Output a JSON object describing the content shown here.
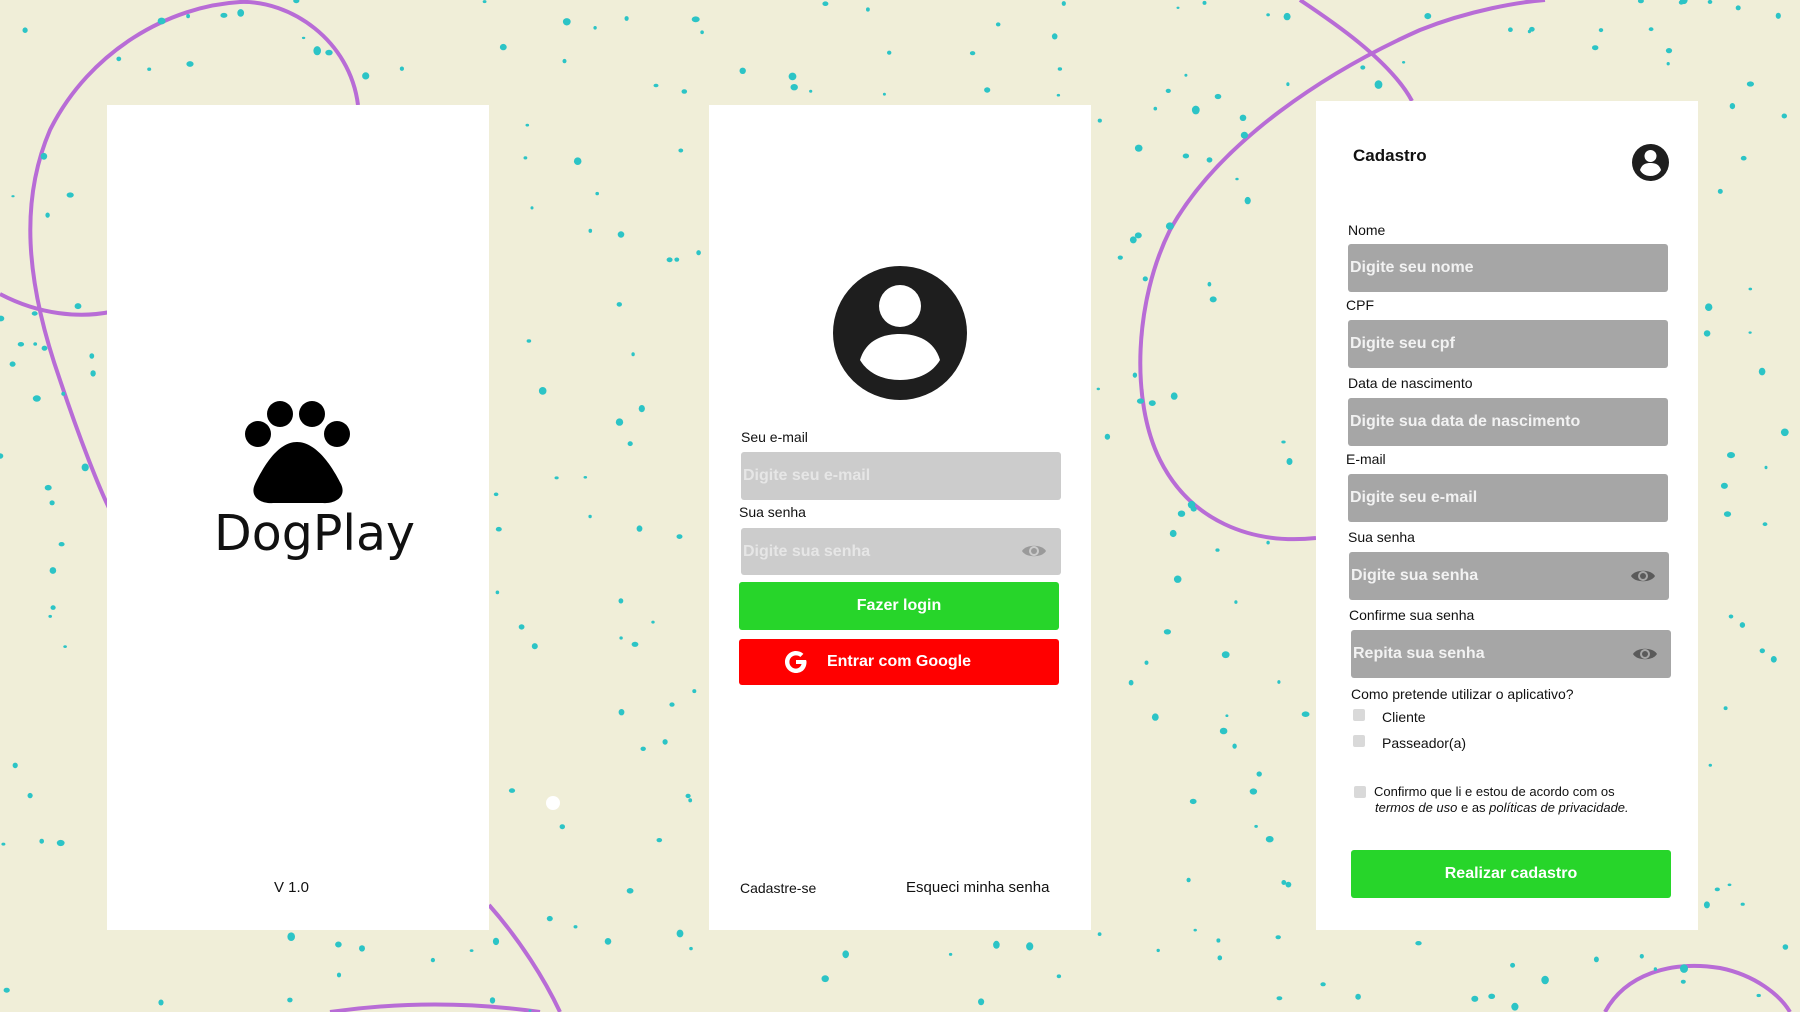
{
  "colors": {
    "background": "#f0eed8",
    "decor_curve": "#b86cd6",
    "decor_dots": "#2cc4c6",
    "login_button": "#27d52a",
    "google_button": "#ff0000",
    "field_login": "#cccccc",
    "field_register": "#a6a6a6",
    "icon_dark": "#1e1e1e"
  },
  "splash": {
    "app_name": "DogPlay",
    "logo_icon": "paw-icon",
    "version": "V 1.0"
  },
  "login": {
    "avatar_icon": "user-circle-icon",
    "email_label": "Seu e-mail",
    "email_placeholder": "Digite seu e-mail",
    "password_label": "Sua senha",
    "password_placeholder": "Digite sua senha",
    "password_toggle_icon": "eye-icon",
    "login_button": "Fazer login",
    "google_icon": "google-g-icon",
    "google_button": "Entrar com Google",
    "signup_link": "Cadastre-se",
    "forgot_link": "Esqueci minha senha"
  },
  "register": {
    "title": "Cadastro",
    "profile_icon": "user-circle-icon",
    "name_label": "Nome",
    "name_placeholder": "Digite seu nome",
    "cpf_label": "CPF",
    "cpf_placeholder": "Digite seu cpf",
    "birth_label": "Data de nascimento",
    "birth_placeholder": "Digite sua data de nascimento",
    "email_label": "E-mail",
    "email_placeholder": "Digite seu e-mail",
    "password_label": "Sua senha",
    "password_placeholder": "Digite sua senha",
    "confirm_label": "Confirme sua senha",
    "confirm_placeholder": "Repita sua senha",
    "usage_question": "Como pretende utilizar o aplicativo?",
    "option_client": "Cliente",
    "option_walker": "Passeador(a)",
    "terms_line1": "Confirmo que li e estou de acordo com os",
    "terms_of_use": "termos de uso",
    "terms_and": " e as ",
    "privacy_policies": "políticas de privacidade",
    "terms_period": ".",
    "submit_button": "Realizar cadastro"
  }
}
